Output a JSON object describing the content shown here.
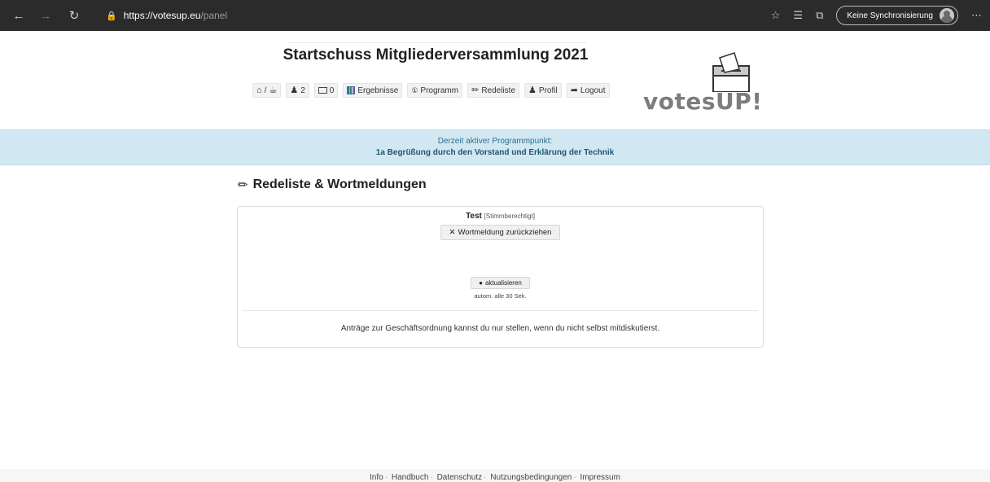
{
  "browser": {
    "url_host": "https://votesup.eu",
    "url_path": "/panel",
    "sync_label": "Keine Synchronisierung"
  },
  "header": {
    "title": "Startschuss Mitgliederversammlung 2021",
    "nav": {
      "home_label": "/",
      "members_count": "2",
      "messages_count": "0",
      "results_label": "Ergebnisse",
      "program_label": "Programm",
      "speakers_label": "Redeliste",
      "profile_label": "Profil",
      "logout_label": "Logout"
    },
    "logo_text": "votesUP!"
  },
  "banner": {
    "caption": "Derzeit aktiver Programmpunkt:",
    "item": "1a Begrüßung durch den Vorstand und Erklärung der Technik"
  },
  "section": {
    "title": "Redeliste & Wortmeldungen"
  },
  "card": {
    "speaker_name": "Test",
    "speaker_tag": "[Stimmberechtigt]",
    "withdraw_label": "Wortmeldung zurückziehen",
    "refresh_label": "aktualisieren",
    "refresh_note": "autom. alle 30 Sek.",
    "footer_text": "Anträge zur Geschäftsordnung kannst du nur stellen, wenn du nicht selbst mitdiskutierst."
  },
  "footer": {
    "links": [
      "Info",
      "Handbuch",
      "Datenschutz",
      "Nutzungsbedingungen",
      "Impressum"
    ]
  }
}
